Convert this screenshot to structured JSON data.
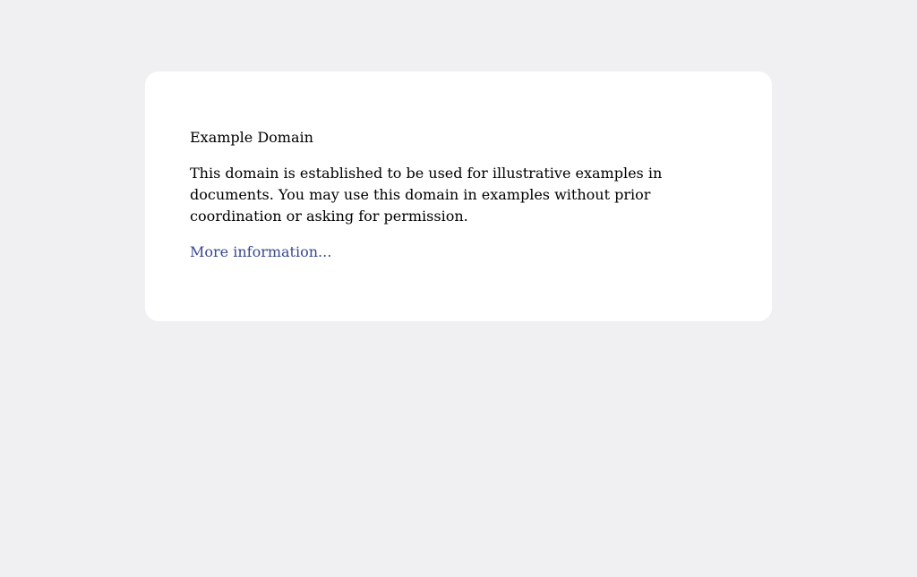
{
  "page": {
    "background_color": "#f0f0f2",
    "card_color": "#ffffff",
    "link_color": "#38488f"
  },
  "content": {
    "heading": "Example Domain",
    "paragraph": "This domain is established to be used for illustrative examples in documents. You may use this domain in examples without prior coordination or asking for permission.",
    "link_text": "More information..."
  }
}
